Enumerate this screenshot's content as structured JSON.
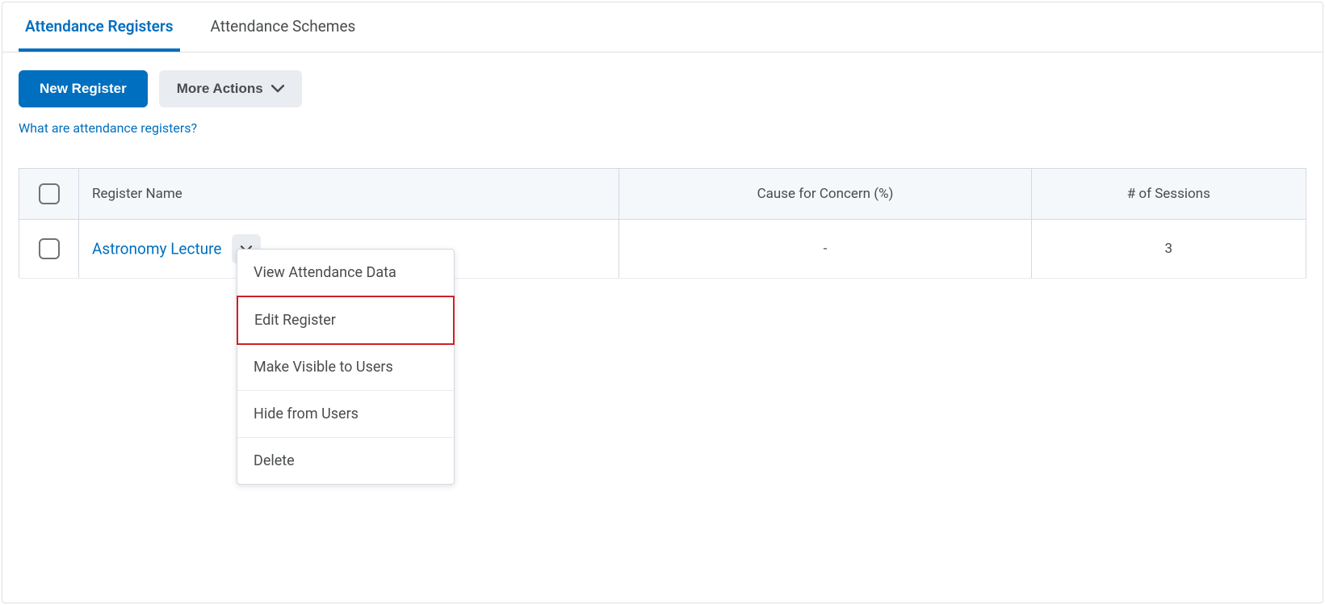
{
  "tabs": {
    "registers": "Attendance Registers",
    "schemes": "Attendance Schemes"
  },
  "toolbar": {
    "new_register": "New Register",
    "more_actions": "More Actions"
  },
  "help_link": "What are attendance registers?",
  "table": {
    "headers": {
      "name": "Register Name",
      "concern": "Cause for Concern (%)",
      "sessions": "# of Sessions"
    },
    "row": {
      "name": "Astronomy Lecture",
      "concern": "-",
      "sessions": "3"
    }
  },
  "dropdown": {
    "view_data": "View Attendance Data",
    "edit": "Edit Register",
    "make_visible": "Make Visible to Users",
    "hide": "Hide from Users",
    "delete": "Delete"
  }
}
